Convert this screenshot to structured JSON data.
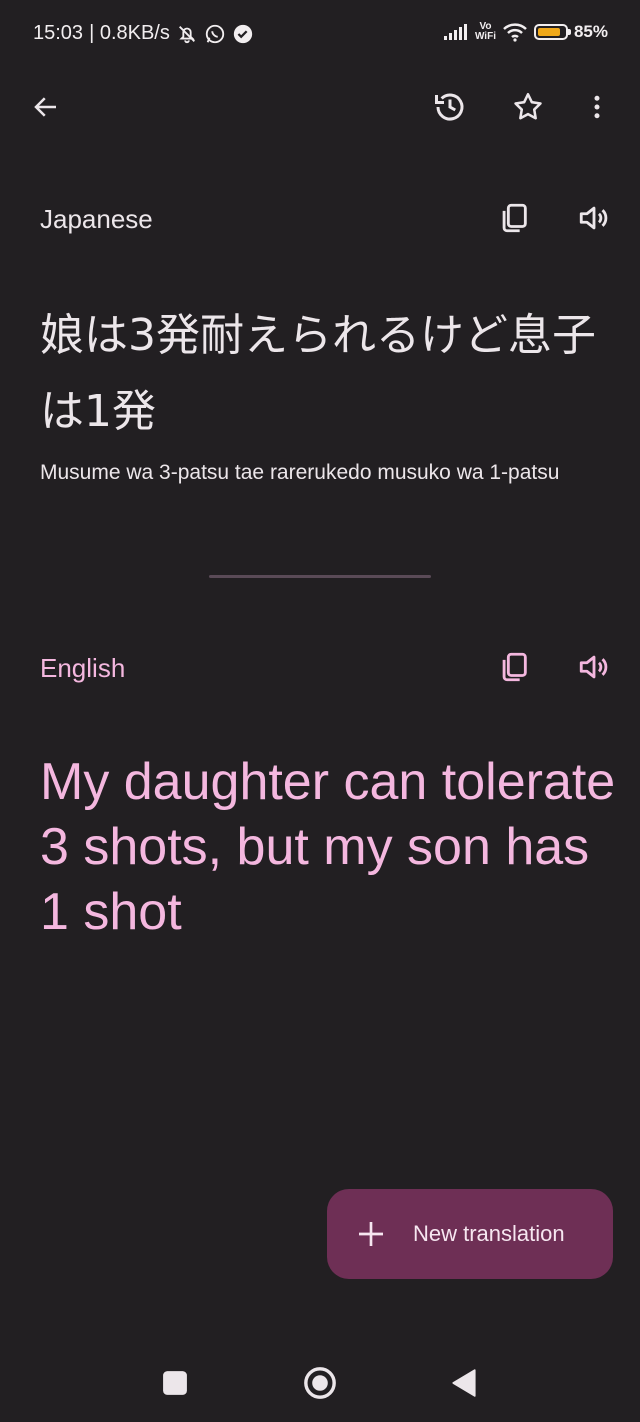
{
  "status_bar": {
    "time": "15:03",
    "net_speed": "| 0.8KB/s",
    "vowifi_top": "Vo",
    "vowifi_bottom": "WiFi",
    "battery_level": 0.85,
    "battery_percent": "85%"
  },
  "app_bar": {
    "icons": [
      "arrow-back-icon",
      "history-icon",
      "star-icon",
      "more-vert-icon"
    ]
  },
  "source": {
    "language": "Japanese",
    "text": "娘は3発耐えられるけど息子は1発",
    "romanization": "Musume wa 3-patsu tae rarerukedo musuko wa 1-patsu"
  },
  "target": {
    "language": "English",
    "text": "My daughter can tolerate 3 shots, but my son has 1 shot"
  },
  "fab": {
    "label": "New translation"
  },
  "colors": {
    "background": "#221f22",
    "accent_text": "#f4b7df",
    "fab_background": "#6e2f55"
  }
}
